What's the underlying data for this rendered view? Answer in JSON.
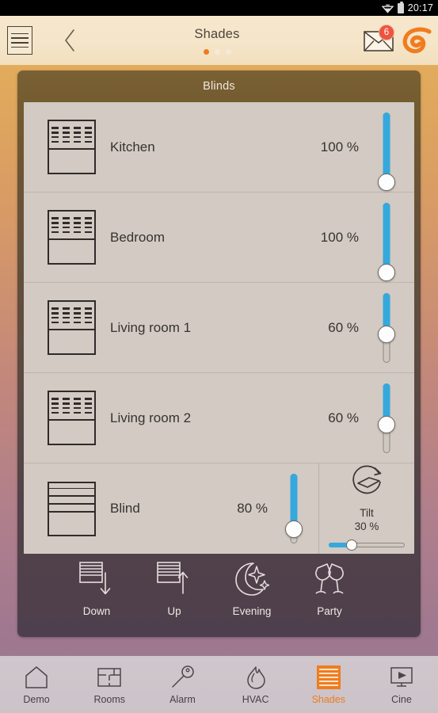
{
  "status_bar": {
    "time": "20:17",
    "wifi_icon": "wifi-icon",
    "battery_icon": "battery-icon"
  },
  "header": {
    "menu_icon": "menu-icon",
    "back_icon": "back-chevron-icon",
    "title": "Shades",
    "pager": {
      "count": 3,
      "active": 1
    },
    "mail_icon": "mail-icon",
    "mail_badge": "6",
    "logo_icon": "brand-logo-icon"
  },
  "card": {
    "title": "Blinds",
    "rows": [
      {
        "name": "Kitchen",
        "value": "100 %",
        "percent": 100,
        "icon": "blind-slats-icon"
      },
      {
        "name": "Bedroom",
        "value": "100 %",
        "percent": 100,
        "icon": "blind-slats-icon"
      },
      {
        "name": "Living room 1",
        "value": "60 %",
        "percent": 60,
        "icon": "blind-slats-icon"
      },
      {
        "name": "Living room 2",
        "value": "60 %",
        "percent": 60,
        "icon": "blind-slats-icon"
      },
      {
        "name": "Blind",
        "value": "80 %",
        "percent": 80,
        "icon": "blind-lines-icon",
        "tilt": {
          "icon": "tilt-rotate-icon",
          "label": "Tilt",
          "value": "30 %",
          "percent": 30
        }
      }
    ]
  },
  "scenes": [
    {
      "label": "Down",
      "icon": "blind-down-icon"
    },
    {
      "label": "Up",
      "icon": "blind-up-icon"
    },
    {
      "label": "Evening",
      "icon": "moon-stars-icon"
    },
    {
      "label": "Party",
      "icon": "champagne-glasses-icon"
    }
  ],
  "bottom_nav": {
    "active": "Shades",
    "items": [
      {
        "label": "Demo",
        "icon": "home-icon"
      },
      {
        "label": "Rooms",
        "icon": "floorplan-icon"
      },
      {
        "label": "Alarm",
        "icon": "key-icon"
      },
      {
        "label": "HVAC",
        "icon": "flame-icon"
      },
      {
        "label": "Shades",
        "icon": "shades-icon"
      },
      {
        "label": "Cine",
        "icon": "screen-play-icon"
      }
    ]
  },
  "colors": {
    "accent": "#ef7b1f",
    "slider_fill": "#35a8dd",
    "badge": "#ef5340",
    "list_bg": "#d2cac3"
  }
}
